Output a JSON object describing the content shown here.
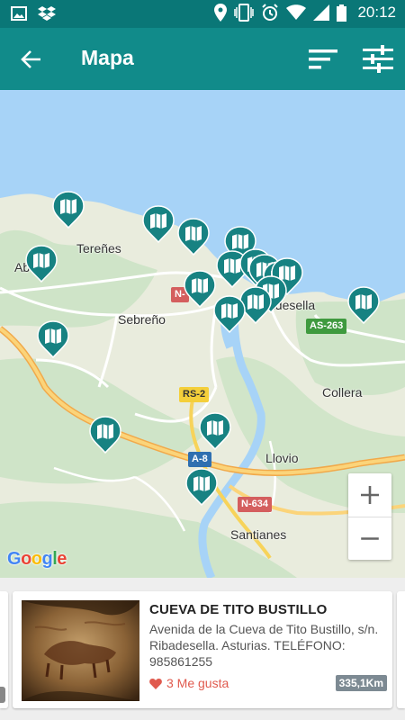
{
  "status_bar": {
    "time": "20:12",
    "icons": [
      "image-icon",
      "dropbox-icon",
      "location-icon",
      "vibrate-icon",
      "alarm-icon",
      "wifi-icon",
      "signal-icon",
      "battery-icon"
    ]
  },
  "app_bar": {
    "title": "Mapa",
    "icons": [
      "back-arrow-icon",
      "sort-icon",
      "filter-sliders-icon"
    ]
  },
  "map": {
    "labels": {
      "terenes": "Tereñes",
      "ab": "Ab",
      "sebreno": "Sebreño",
      "ribadesella": "adesella",
      "collera": "Collera",
      "llovio": "Llovio",
      "santianes": "Santianes"
    },
    "road_shields": {
      "n_partial": "N-",
      "as263": "AS-263",
      "rs2": "RS-2",
      "a8": "A-8",
      "n634": "N-634"
    },
    "marker_icon": "map-marker-icon",
    "zoom_in": "+",
    "zoom_out": "−",
    "attribution": "Google",
    "colors": {
      "sea": "#a7d3f7",
      "land": "#e9ecdd",
      "marker": "#178282",
      "highway": "#f7b644"
    }
  },
  "card": {
    "title": "CUEVA DE TITO BUSTILLO",
    "description": "Avenida de la Cueva de Tito Bustillo, s/n. Ribadesella. Asturias. TELÉFONO: 985861255",
    "likes": "3 Me gusta",
    "distance": "335,1Km"
  }
}
